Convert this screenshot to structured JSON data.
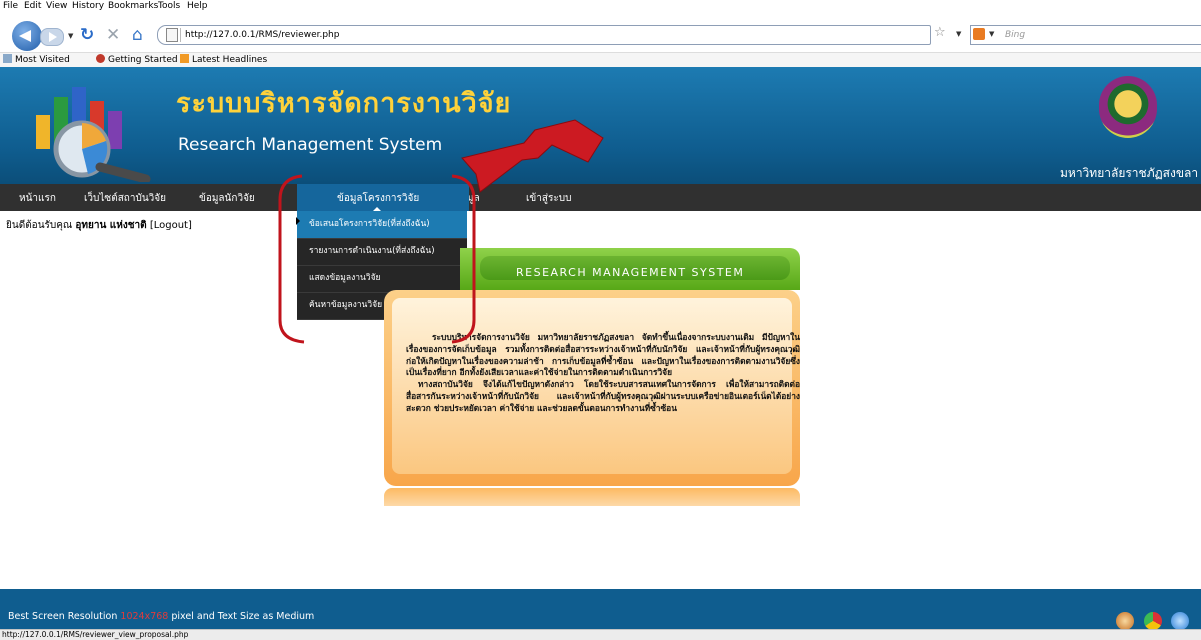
{
  "browser": {
    "menu": [
      "File",
      "Edit",
      "View",
      "History",
      "Bookmarks",
      "Tools",
      "Help"
    ],
    "url": "http://127.0.0.1/RMS/reviewer.php",
    "search_placeholder": "Bing",
    "bookmarks": [
      "Most Visited",
      "Getting Started",
      "Latest Headlines"
    ],
    "status_url": "http://127.0.0.1/RMS/reviewer_view_proposal.php"
  },
  "header": {
    "title_th": "ระบบบริหารจัดการงานวิจัย",
    "title_en": "Research Management System",
    "university": "มหาวิทยาลัยราชภัฏสงขลา"
  },
  "nav": {
    "items": [
      "หน้าแรก",
      "เว็บไซต์สถาบันวิจัย",
      "ข้อมูลนักวิจัย",
      "ข้อมูลโครงการวิจัย",
      "รายงานข้อมูล",
      "เข้าสู่ระบบ"
    ],
    "dropdown": [
      "ข้อเสนอโครงการวิจัย(ที่ส่งถึงฉัน)",
      "รายงานการดำเนินงาน(ที่ส่งถึงฉัน)",
      "แสดงข้อมูลงานวิจัย",
      "ค้นหาข้อมูลงานวิจัย"
    ]
  },
  "user": {
    "greeting": "ยินดีต้อนรับคุณ",
    "name": "อุทยาน แห่งชาติ",
    "logout": "[Logout]"
  },
  "banner": {
    "text": "RESEARCH MANAGEMENT SYSTEM"
  },
  "content": {
    "paragraph1": "ระบบบริหารจัดการงานวิจัย มหาวิทยาลัยราชภัฏสงขลา จัดทำขึ้นเนื่องจากระบบงานเดิม มีปัญหาในเรื่องของการจัดเก็บข้อมูล รวมทั้งการติดต่อสื่อสารระหว่างเจ้าหน้าที่กับนักวิจัย และเจ้าหน้าที่กับผู้ทรงคุณวุฒิ ก่อให้เกิดปัญหาในเรื่องของความล่าช้า การเก็บข้อมูลที่ซ้ำซ้อน และปัญหาในเรื่องของการติดตามงานวิจัยซึ่งเป็นเรื่องที่ยาก อีกทั้งยังเสียเวลาและค่าใช้จ่ายในการติดตามดำเนินการวิจัย",
    "paragraph2": "ทางสถาบันวิจัย จึงได้แก้ไขปัญหาดังกล่าว โดยใช้ระบบสารสนเทศในการจัดการ เพื่อให้สามารถติดต่อสื่อสารกันระหว่างเจ้าหน้าที่กับนักวิจัย และเจ้าหน้าที่กับผู้ทรงคุณวุฒิผ่านระบบเครือข่ายอินเตอร์เน็ตได้อย่างสะดวก ช่วยประหยัดเวลา ค่าใช้จ่าย และช่วยลดขั้นตอนการทำงานที่ซ้ำซ้อน"
  },
  "footer": {
    "text_before": "Best Screen Resolution ",
    "resolution": "1024x768",
    "text_after": " pixel and Text Size as Medium"
  },
  "colors": {
    "header_blue": "#1d7bb2",
    "menu_dark": "#303030",
    "title_yellow": "#ffd23a",
    "annotation_red": "#c0141c",
    "banner_green": "#57a817",
    "content_orange": "#f8a64a"
  }
}
